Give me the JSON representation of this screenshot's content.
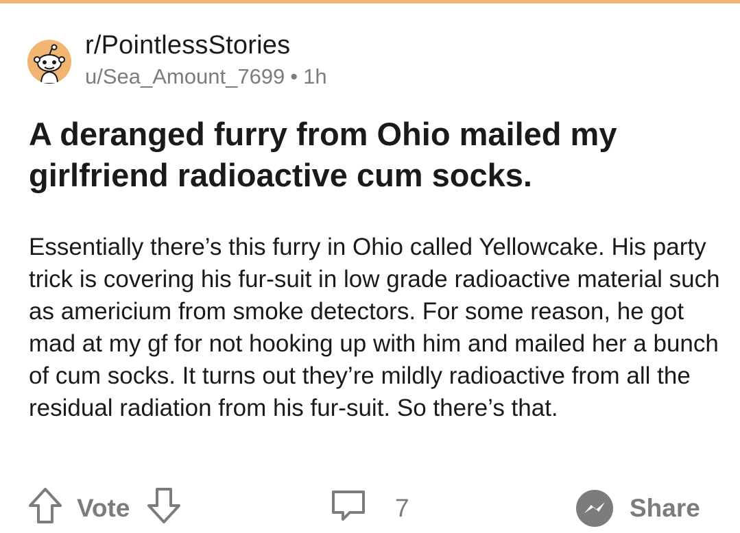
{
  "post": {
    "subreddit": "r/PointlessStories",
    "author": "u/Sea_Amount_7699",
    "separator": "•",
    "age": "1h",
    "title": "A deranged furry from Ohio mailed my girlfriend radioactive cum socks.",
    "body": "Essentially there’s this furry in Ohio called Yellowcake. His party trick is covering his fur-suit in low grade radioactive material such as americium from smoke detectors. For some reason, he got mad at my gf for not hooking up with him and mailed her a bunch of cum socks. It turns out they’re mildly radioactive from all the residual radiation from his fur-suit. So there’s that."
  },
  "actions": {
    "vote_label": "Vote",
    "comment_count": "7",
    "share_label": "Share"
  },
  "icons": {
    "avatar": "snoo-avatar-icon",
    "upvote": "upvote-arrow-icon",
    "downvote": "downvote-arrow-icon",
    "comment": "comment-bubble-icon",
    "share": "share-icon"
  },
  "colors": {
    "accent": "#f0b571",
    "text": "#1a1a1b",
    "muted": "#7c7c7c"
  }
}
